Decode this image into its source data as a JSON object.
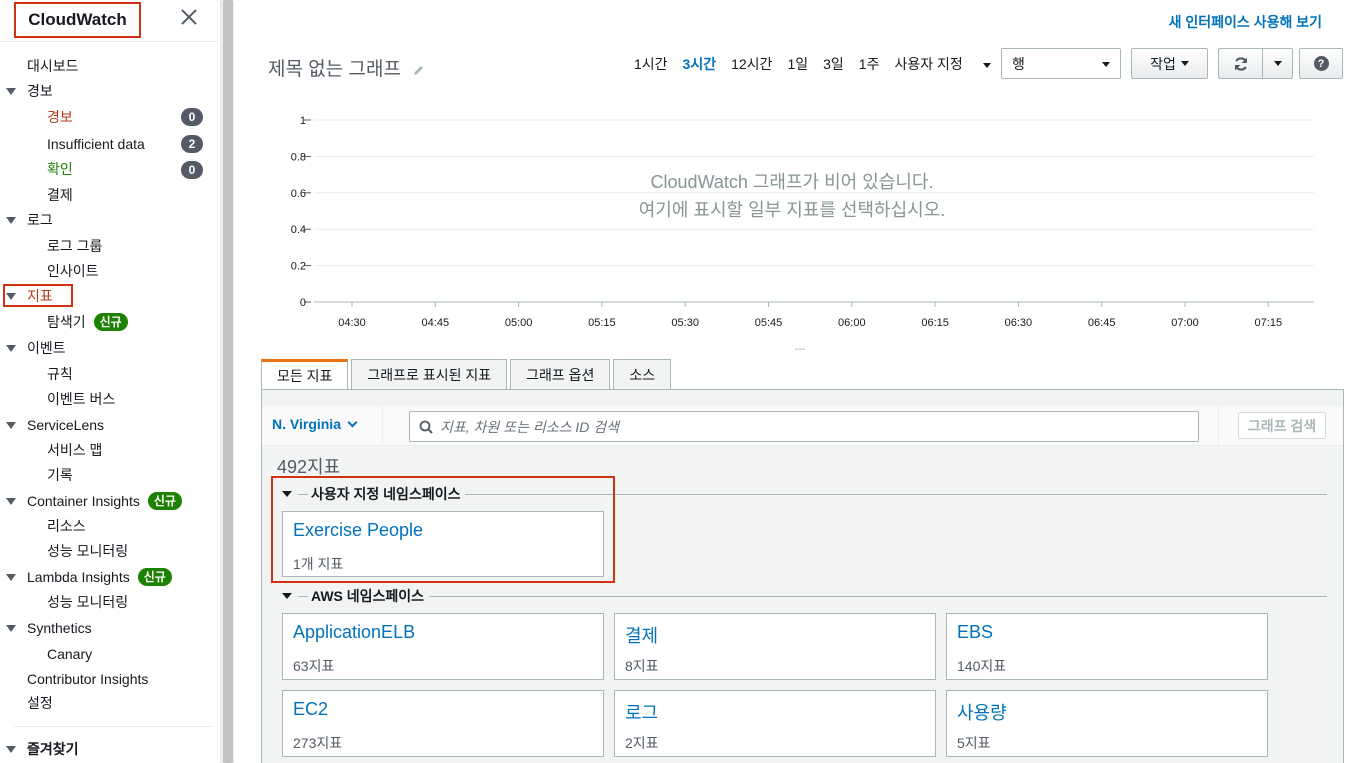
{
  "sidebar": {
    "brand": "CloudWatch",
    "items": {
      "dashboard": "대시보드",
      "alarms": "경보",
      "alarms_alarm": "경보",
      "alarms_alarm_count": "0",
      "alarms_insufficient": "Insufficient data",
      "alarms_insufficient_count": "2",
      "alarms_ok": "확인",
      "alarms_ok_count": "0",
      "billing": "결제",
      "logs": "로그",
      "log_groups": "로그 그룹",
      "insights": "인사이트",
      "metrics": "지표",
      "explorer": "탐색기",
      "events": "이벤트",
      "rules": "규칙",
      "event_buses": "이벤트 버스",
      "servicelens": "ServiceLens",
      "service_map": "서비스 맵",
      "traces": "기록",
      "container_insights": "Container Insights",
      "resources": "리소스",
      "perf_monitoring_1": "성능 모니터링",
      "lambda_insights": "Lambda Insights",
      "perf_monitoring_2": "성능 모니터링",
      "synthetics": "Synthetics",
      "canary": "Canary",
      "contributor_insights": "Contributor Insights",
      "settings": "설정",
      "favorites": "즐겨찾기"
    },
    "new_badge": "신규"
  },
  "header": {
    "try_new": "새 인터페이스 사용해 보기",
    "graph_title": "제목 없는 그래프",
    "ranges": [
      "1시간",
      "3시간",
      "12시간",
      "1일",
      "3일",
      "1주"
    ],
    "active_range": "3시간",
    "custom_range": "사용자 지정",
    "view_select": "행",
    "actions": "작업",
    "help": "?"
  },
  "chart_data": {
    "type": "line",
    "x": [
      "04:30",
      "04:45",
      "05:00",
      "05:15",
      "05:30",
      "05:45",
      "06:00",
      "06:15",
      "06:30",
      "06:45",
      "07:00",
      "07:15"
    ],
    "y_ticks": [
      "0",
      "0.2",
      "0.4",
      "0.6",
      "0.8",
      "1"
    ],
    "ylim": [
      0,
      1
    ],
    "series": [],
    "empty_line1": "CloudWatch 그래프가 비어 있습니다.",
    "empty_line2": "여기에 표시할 일부 지표를 선택하십시오.",
    "grid": true
  },
  "tabs": [
    "모든 지표",
    "그래프로 표시된 지표",
    "그래프 옵션",
    "소스"
  ],
  "browser": {
    "region": "N. Virginia",
    "search_placeholder": "지표, 차원 또는 리소스 ID 검색",
    "search_button": "그래프 검색",
    "metric_count": "492지표",
    "custom_ns_label": "사용자 지정 네임스페이스",
    "custom_ns": [
      {
        "name": "Exercise People",
        "count": "1개 지표"
      }
    ],
    "aws_ns_label": "AWS 네임스페이스",
    "aws_ns": [
      {
        "name": "ApplicationELB",
        "count": "63지표"
      },
      {
        "name": "결제",
        "count": "8지표"
      },
      {
        "name": "EBS",
        "count": "140지표"
      },
      {
        "name": "EC2",
        "count": "273지표"
      },
      {
        "name": "로그",
        "count": "2지표"
      },
      {
        "name": "사용량",
        "count": "5지표"
      }
    ]
  },
  "colors": {
    "accent": "#0073bb",
    "highlight": "#d13212",
    "badge": "#1d8102",
    "tab_active": "#ec7211"
  }
}
